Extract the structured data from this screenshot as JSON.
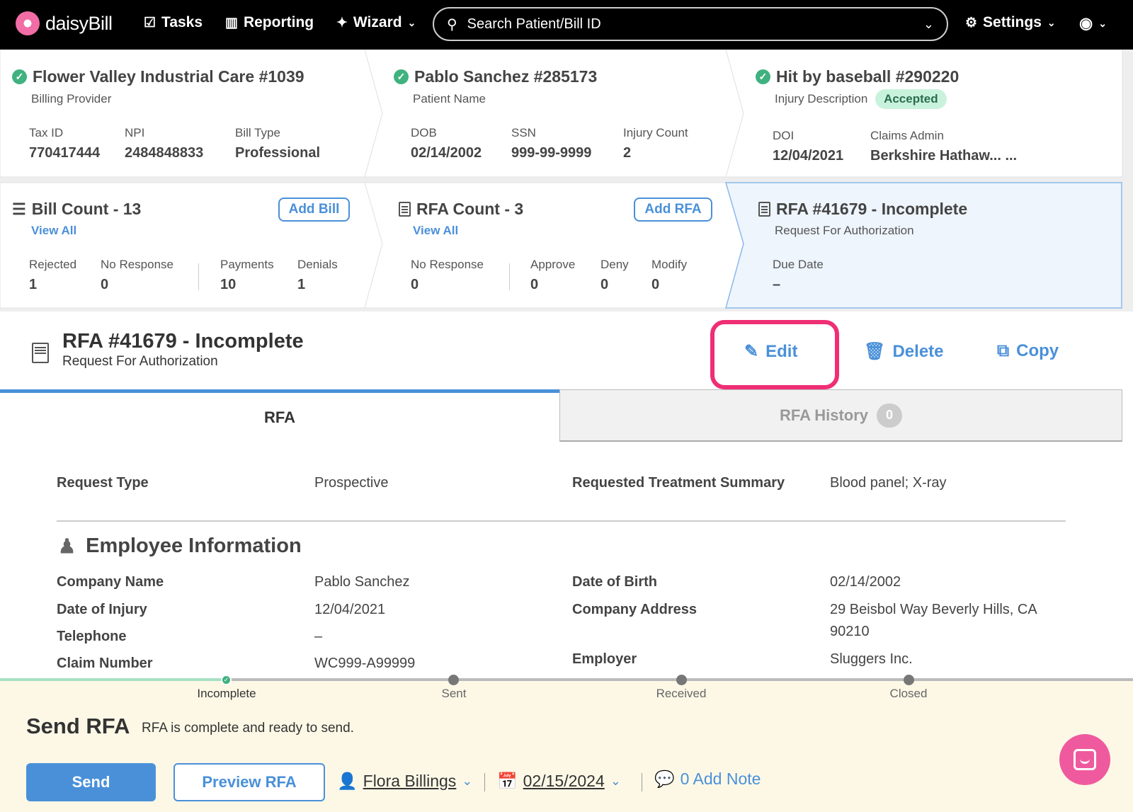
{
  "nav": {
    "brand": "daisyBill",
    "tasks": "Tasks",
    "reporting": "Reporting",
    "wizard": "Wizard",
    "search_placeholder": "Search Patient/Bill ID",
    "settings": "Settings"
  },
  "provider": {
    "title": "Flower Valley Industrial Care #1039",
    "subtitle": "Billing Provider",
    "tax_id_label": "Tax ID",
    "tax_id": "770417444",
    "npi_label": "NPI",
    "npi": "2484848833",
    "bill_type_label": "Bill Type",
    "bill_type": "Professional"
  },
  "patient": {
    "title": "Pablo Sanchez #285173",
    "subtitle": "Patient Name",
    "dob_label": "DOB",
    "dob": "02/14/2002",
    "ssn_label": "SSN",
    "ssn": "999-99-9999",
    "injury_count_label": "Injury Count",
    "injury_count": "2"
  },
  "injury": {
    "title": "Hit by baseball #290220",
    "subtitle": "Injury Description",
    "status": "Accepted",
    "doi_label": "DOI",
    "doi": "12/04/2021",
    "claims_admin_label": "Claims Admin",
    "claims_admin": "Berkshire Hathaw... ..."
  },
  "bills": {
    "title": "Bill Count - 13",
    "add_label": "Add Bill",
    "view_all": "View All",
    "rejected_label": "Rejected",
    "rejected": "1",
    "no_response_label": "No Response",
    "no_response": "0",
    "payments_label": "Payments",
    "payments": "10",
    "denials_label": "Denials",
    "denials": "1"
  },
  "rfas": {
    "title": "RFA Count - 3",
    "add_label": "Add RFA",
    "view_all": "View All",
    "no_response_label": "No Response",
    "no_response": "0",
    "approve_label": "Approve",
    "approve": "0",
    "deny_label": "Deny",
    "deny": "0",
    "modify_label": "Modify",
    "modify": "0"
  },
  "current_rfa": {
    "title": "RFA #41679 - Incomplete",
    "subtitle": "Request For Authorization",
    "due_date_label": "Due Date",
    "due_date": "–"
  },
  "rfa_header": {
    "title": "RFA #41679 - Incomplete",
    "subtitle": "Request For Authorization",
    "edit": "Edit",
    "delete": "Delete",
    "copy": "Copy"
  },
  "tabs": {
    "rfa": "RFA",
    "history": "RFA History",
    "history_count": "0"
  },
  "details": {
    "request_type_label": "Request Type",
    "request_type": "Prospective",
    "summary_label": "Requested Treatment Summary",
    "summary": "Blood panel; X-ray",
    "section_title": "Employee Information",
    "company_name_label": "Company Name",
    "company_name": "Pablo Sanchez",
    "dob_label": "Date of Birth",
    "dob": "02/14/2002",
    "doi_label": "Date of Injury",
    "doi": "12/04/2021",
    "address_label": "Company Address",
    "address_line1": "29 Beisbol Way Beverly Hills, CA",
    "address_line2": "90210",
    "telephone_label": "Telephone",
    "telephone": "–",
    "claim_label": "Claim Number",
    "claim": "WC999-A99999",
    "employer_label": "Employer",
    "employer": "Sluggers Inc."
  },
  "progress": {
    "steps": [
      "Incomplete",
      "Sent",
      "Received",
      "Closed"
    ],
    "current_index": 0
  },
  "send_panel": {
    "title": "Send RFA",
    "subtitle": "RFA is complete and ready to send.",
    "send": "Send",
    "preview": "Preview RFA",
    "assignee": "Flora Billings",
    "date": "02/15/2024",
    "note": "0 Add Note"
  }
}
